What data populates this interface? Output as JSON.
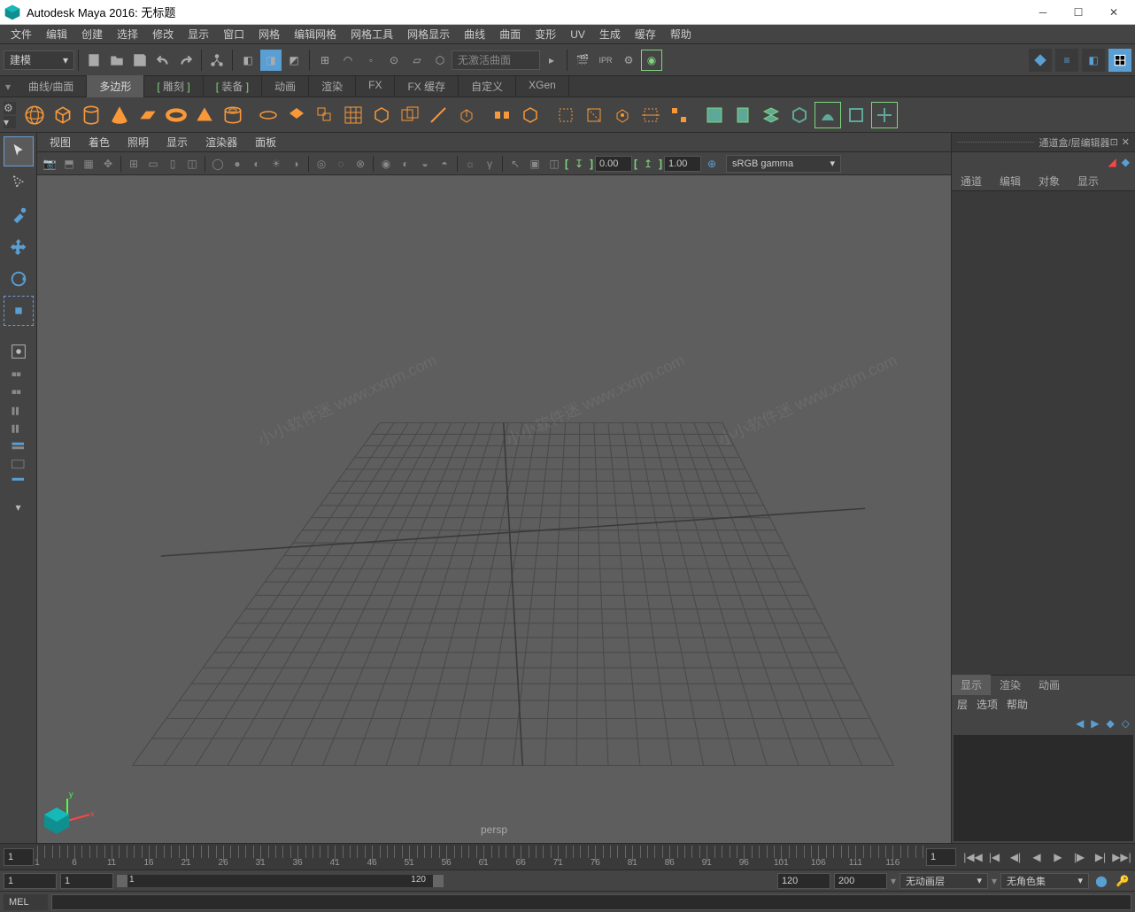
{
  "titlebar": {
    "title": "Autodesk Maya 2016: 无标题"
  },
  "menubar": {
    "items": [
      "文件",
      "编辑",
      "创建",
      "选择",
      "修改",
      "显示",
      "窗口",
      "网格",
      "编辑网格",
      "网格工具",
      "网格显示",
      "曲线",
      "曲面",
      "变形",
      "UV",
      "生成",
      "缓存",
      "帮助"
    ]
  },
  "workspace": {
    "dropdown": "建模"
  },
  "toolbar1": {
    "surface_search": "无激活曲面"
  },
  "shelf": {
    "tabs": [
      "曲线/曲面",
      "多边形",
      "雕刻",
      "装备",
      "动画",
      "渲染",
      "FX",
      "FX 缓存",
      "自定义",
      "XGen"
    ],
    "active_index": 1
  },
  "viewport": {
    "menu": [
      "视图",
      "着色",
      "照明",
      "显示",
      "渲染器",
      "面板"
    ],
    "near": "0.00",
    "far": "1.00",
    "gamma": "sRGB gamma",
    "camera": "persp",
    "watermark": "小小软件迷 www.xxrjm.com"
  },
  "rightpanel": {
    "title": "通道盒/层编辑器",
    "tabs": [
      "通道",
      "编辑",
      "对象",
      "显示"
    ],
    "layertabs": [
      "显示",
      "渲染",
      "动画"
    ],
    "layer_active": 0,
    "layermenu": [
      "层",
      "选项",
      "帮助"
    ]
  },
  "timeline": {
    "current": "1",
    "ruler_start": 1,
    "ruler_end": 120,
    "tick_step": 5,
    "end_current": "1"
  },
  "rangebar": {
    "start": "1",
    "playback_start": "1",
    "playback_end": "120",
    "end": "120",
    "range_end": "200",
    "anim_layer": "无动画层",
    "charset": "无角色集"
  },
  "cmdline": {
    "lang": "MEL"
  }
}
